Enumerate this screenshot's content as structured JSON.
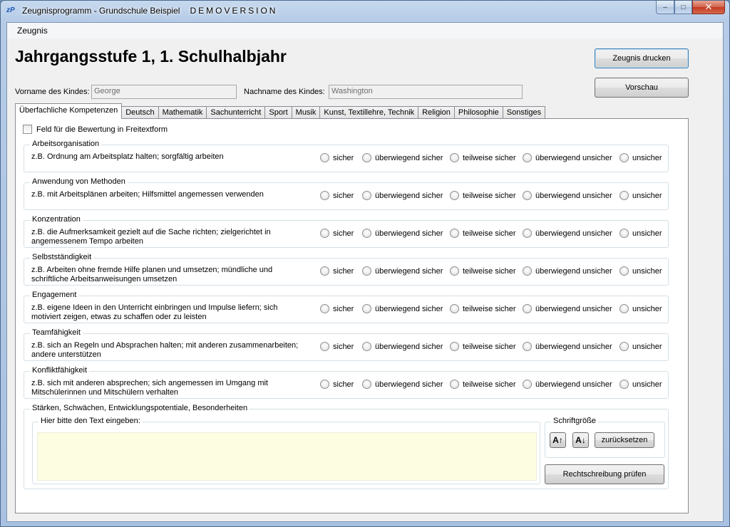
{
  "window": {
    "title": "Zeugnisprogramm - Grundschule Beispiel",
    "title_suffix": "DEMOVERSION",
    "app_icon": "zP",
    "minimize": "–",
    "maximize": "□",
    "close": "✕"
  },
  "menu": {
    "items": [
      "Zeugnis"
    ]
  },
  "page": {
    "heading": "Jahrgangsstufe 1, 1. Schulhalbjahr"
  },
  "buttons": {
    "print": "Zeugnis drucken",
    "preview": "Vorschau"
  },
  "child": {
    "first_name_label": "Vorname des Kindes:",
    "first_name_value": "George",
    "last_name_label": "Nachname des Kindes:",
    "last_name_value": "Washington"
  },
  "tabs": [
    "Überfachliche Kompetenzen",
    "Deutsch",
    "Mathematik",
    "Sachunterricht",
    "Sport",
    "Musik",
    "Kunst, Textillehre, Technik",
    "Religion",
    "Philosophie",
    "Sonstiges"
  ],
  "active_tab": "Überfachliche Kompetenzen",
  "freitext_checkbox": {
    "label": "Feld für die Bewertung in Freitextform",
    "checked": false
  },
  "rating_options": [
    "sicher",
    "überwiegend sicher",
    "teilweise sicher",
    "überwiegend unsicher",
    "unsicher"
  ],
  "competencies": [
    {
      "title": "Arbeitsorganisation",
      "desc": "z.B. Ordnung am Arbeitsplatz halten; sorgfältig arbeiten"
    },
    {
      "title": "Anwendung von Methoden",
      "desc": "z.B. mit Arbeitsplänen arbeiten; Hilfsmittel angemessen verwenden"
    },
    {
      "title": "Konzentration",
      "desc": "z.B. die Aufmerksamkeit gezielt auf die Sache richten; zielgerichtet in angemessenem Tempo arbeiten"
    },
    {
      "title": "Selbstständigkeit",
      "desc": "z.B. Arbeiten ohne fremde Hilfe planen und umsetzen; mündliche und schriftliche Arbeitsanweisungen umsetzen"
    },
    {
      "title": "Engagement",
      "desc": "z.B. eigene Ideen in den Unterricht einbringen und Impulse liefern; sich motiviert zeigen, etwas zu schaffen oder zu leisten"
    },
    {
      "title": "Teamfähigkeit",
      "desc": "z.B. sich an Regeln und Absprachen halten; mit anderen zusammenarbeiten; andere unterstützen"
    },
    {
      "title": "Konfliktfähigkeit",
      "desc": "z.B. sich mit anderen absprechen; sich angemessen im Umgang mit Mitschülerinnen und Mitschülern verhalten"
    }
  ],
  "strengths": {
    "title": "Stärken, Schwächen, Entwicklungspotentiale, Besonderheiten",
    "textarea_label": "Hier bitte den Text eingeben:",
    "textarea_value": "",
    "font_size_label": "Schriftgröße",
    "font_increase": "A↑",
    "font_decrease": "A↓",
    "reset": "zurücksetzen",
    "spellcheck": "Rechtschreibung prüfen"
  }
}
